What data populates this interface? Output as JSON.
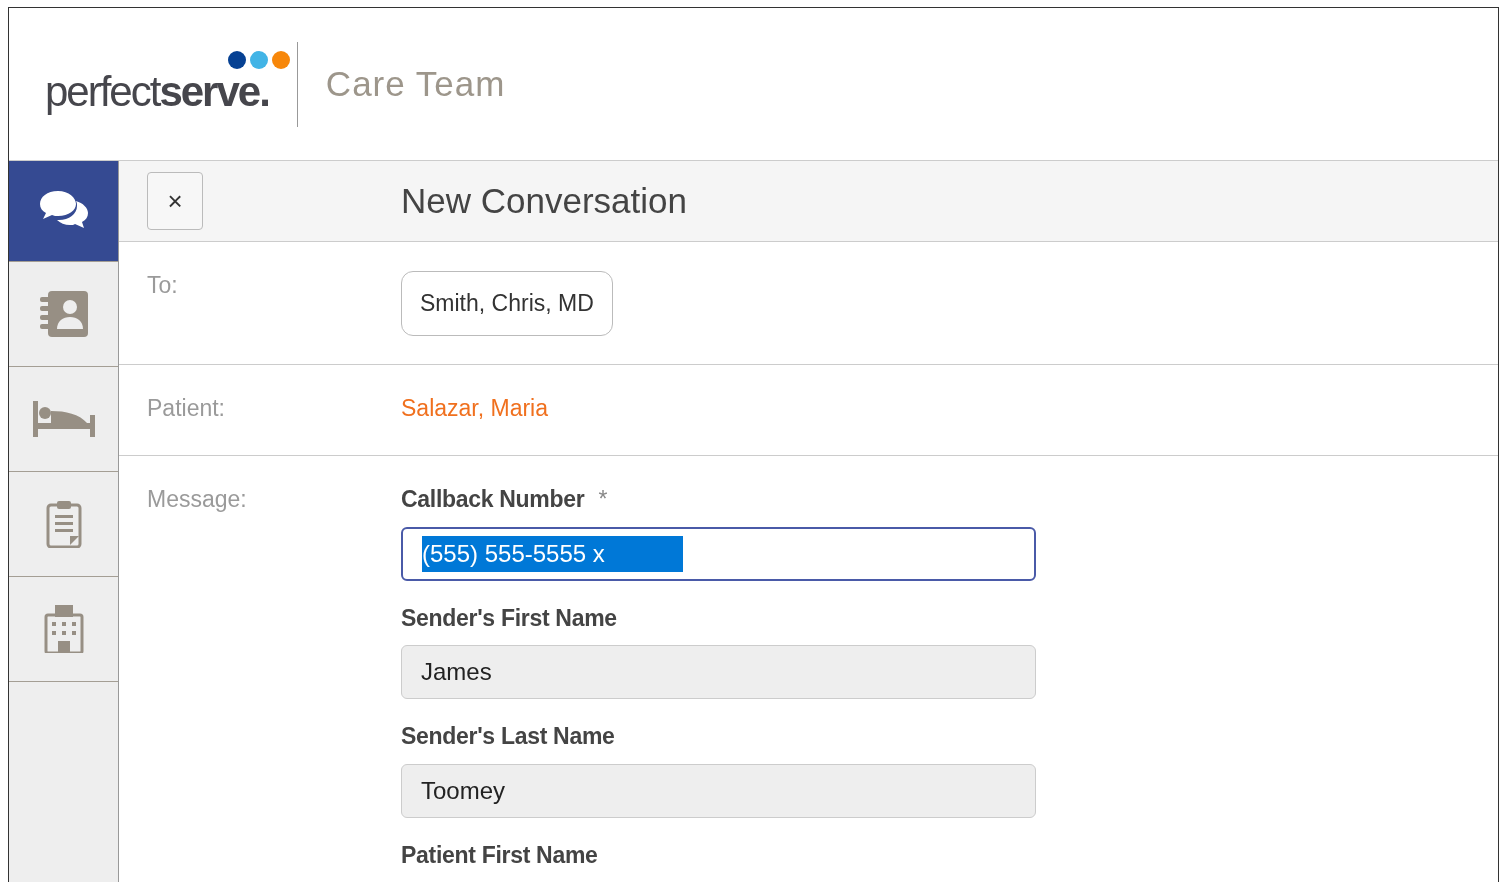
{
  "header": {
    "logo": "perfect**serve.**",
    "app_title": "Care Team"
  },
  "sidebar": {
    "items": [
      {
        "kind": "conversations",
        "selected": true
      },
      {
        "kind": "contacts",
        "selected": false
      },
      {
        "kind": "patients",
        "selected": false
      },
      {
        "kind": "tasks",
        "selected": false
      },
      {
        "kind": "facility",
        "selected": false
      }
    ]
  },
  "conversation": {
    "close": "×",
    "title": "New Conversation",
    "to_label": "To:",
    "recipients": [
      "Smith, Chris, MD"
    ],
    "patient_label": "Patient:",
    "patient": "Salazar, Maria",
    "message_label": "Message:",
    "fields": [
      {
        "label": "Callback Number",
        "required_mark": "*",
        "value": "(555) 555-5555 x",
        "selected": true,
        "editable": true
      },
      {
        "label": "Sender's First Name",
        "value": "James",
        "selected": false,
        "editable": false
      },
      {
        "label": "Sender's Last Name",
        "value": "Toomey",
        "selected": false,
        "editable": false
      },
      {
        "label": "Patient First Name"
      }
    ]
  }
}
